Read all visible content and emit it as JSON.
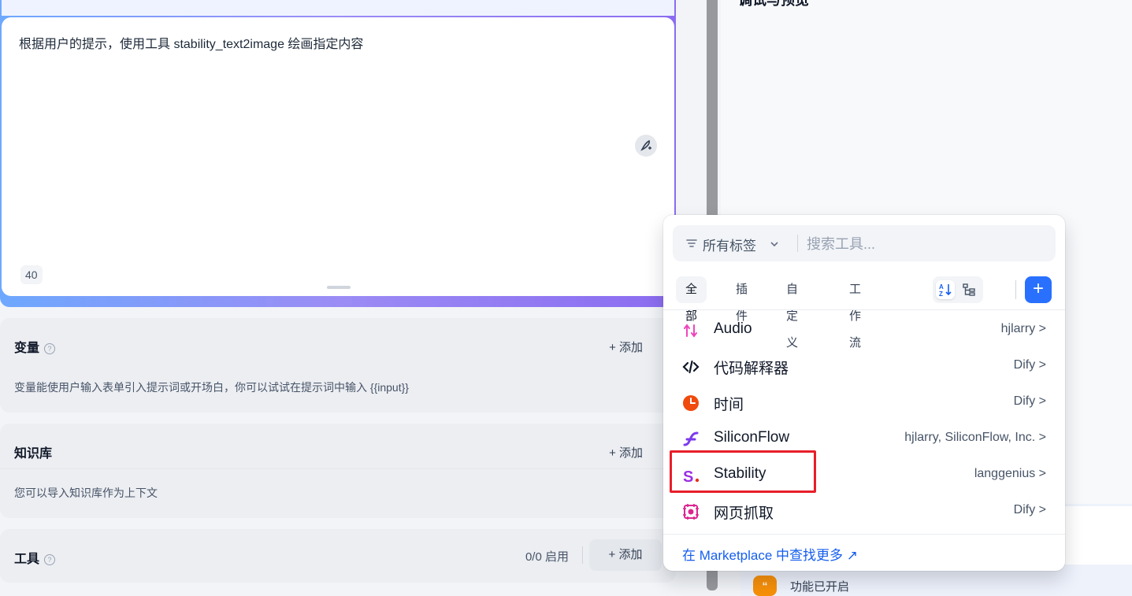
{
  "prompt": {
    "text": "根据用户的提示，使用工具 stability_text2image 绘画指定内容",
    "char_count": "40"
  },
  "variables": {
    "title": "变量",
    "add_label": "+ 添加",
    "description": "变量能使用户输入表单引入提示词或开场白，你可以试试在提示词中输入 {{input}}"
  },
  "knowledge": {
    "title": "知识库",
    "add_label": "+ 添加",
    "description": "您可以导入知识库作为上下文"
  },
  "tools": {
    "title": "工具",
    "count": "0/0 启用",
    "add_label": "+ 添加"
  },
  "right_panel": {
    "title": "调试与预览",
    "feature_text": "功能已开启"
  },
  "dropdown": {
    "tag_filter": "所有标签",
    "search_placeholder": "搜索工具...",
    "tabs": [
      "全部",
      "插件",
      "自定义",
      "工作流"
    ],
    "active_tab": "全部",
    "items": [
      {
        "name": "Audio",
        "author": "hjlarry >",
        "icon": "audio-icon",
        "color": "#ee46bc"
      },
      {
        "name": "代码解释器",
        "author": "Dify >",
        "icon": "code-icon",
        "color": "#101828"
      },
      {
        "name": "时间",
        "author": "Dify >",
        "icon": "clock-icon",
        "color": "#f04a0c"
      },
      {
        "name": "SiliconFlow",
        "author": "hjlarry, SiliconFlow, Inc. >",
        "icon": "siliconflow-icon",
        "color": "#7c3aed"
      },
      {
        "name": "Stability",
        "author": "langgenius >",
        "icon": "stability-icon",
        "color": "#9b2fe3"
      },
      {
        "name": "网页抓取",
        "author": "Dify >",
        "icon": "web-scraper-icon",
        "color": "#dd2590"
      }
    ],
    "marketplace_link": "在 Marketplace 中查找更多 ↗"
  },
  "colors": {
    "primary": "#2970ff",
    "highlight": "#e81e29"
  }
}
